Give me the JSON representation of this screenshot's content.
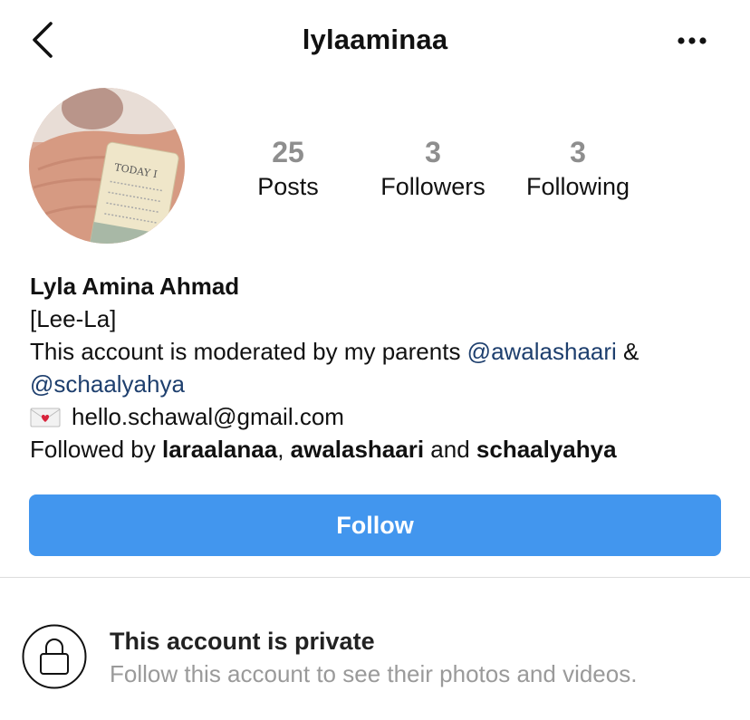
{
  "header": {
    "username": "lylaaminaa"
  },
  "stats": [
    {
      "count": "25",
      "label": "Posts"
    },
    {
      "count": "3",
      "label": "Followers"
    },
    {
      "count": "3",
      "label": "Following"
    }
  ],
  "avatar": {
    "card_text": "TODAY I"
  },
  "bio": {
    "name": "Lyla Amina Ahmad",
    "pronunciation": "[Lee-La]",
    "moderated_text": "This account is moderated by my parents ",
    "mention1": "@awalashaari",
    "amp": " &",
    "mention2": "@schaalyahya",
    "email": "hello.schawal@gmail.com",
    "followed_by_prefix": "Followed by ",
    "followed_by_1": "laraalanaa",
    "followed_by_sep": ", ",
    "followed_by_2": "awalashaari",
    "followed_by_and": " and ",
    "followed_by_3": "schaalyahya"
  },
  "follow_button": {
    "label": "Follow",
    "color": "#4296ee"
  },
  "private": {
    "title": "This account is private",
    "subtitle": "Follow this account to see their photos and videos."
  },
  "icons": {
    "back": "chevron-left-icon",
    "more": "more-horizontal-icon",
    "mail": "love-letter-icon",
    "lock": "lock-icon"
  }
}
